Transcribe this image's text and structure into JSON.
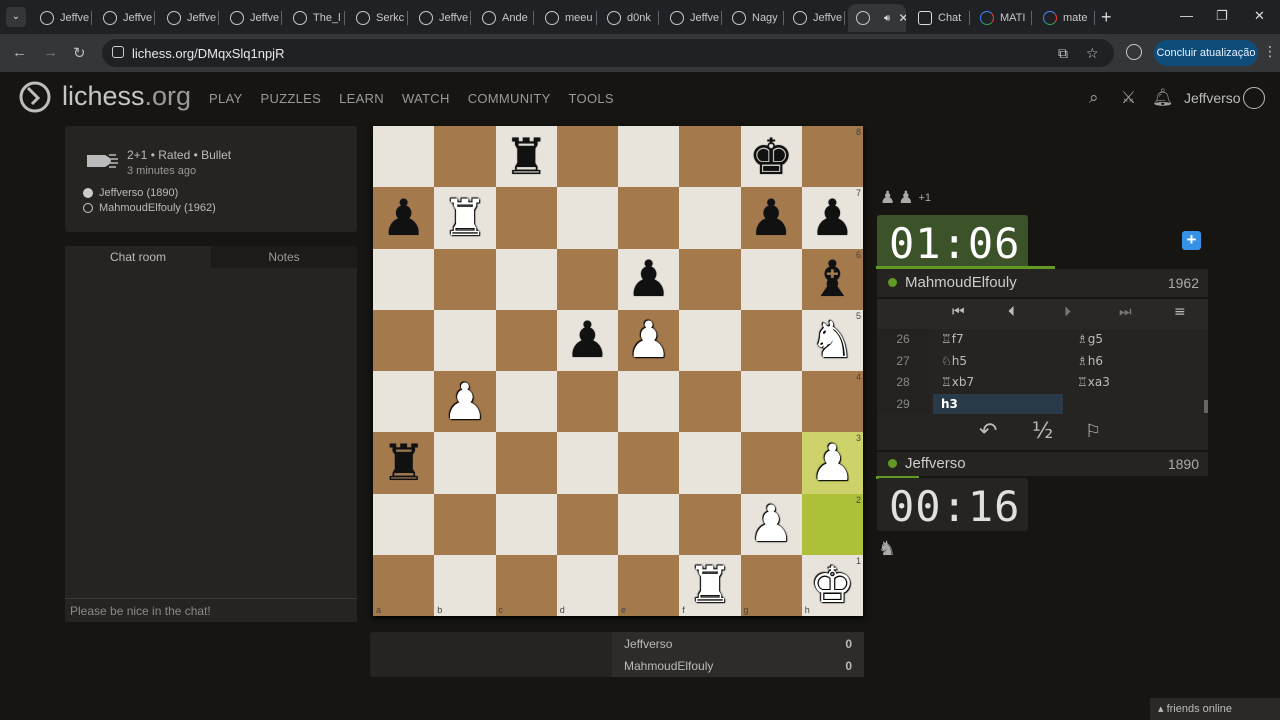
{
  "browser": {
    "tabs": [
      {
        "label": "Jeffve",
        "icon": "lichess-icon"
      },
      {
        "label": "Jeffve",
        "icon": "lichess-icon"
      },
      {
        "label": "Jeffve",
        "icon": "lichess-icon"
      },
      {
        "label": "Jeffve",
        "icon": "lichess-icon"
      },
      {
        "label": "The_l",
        "icon": "lichess-icon"
      },
      {
        "label": "Serkc",
        "icon": "lichess-icon"
      },
      {
        "label": "Jeffve",
        "icon": "lichess-icon"
      },
      {
        "label": "Ande",
        "icon": "lichess-icon"
      },
      {
        "label": "meeu",
        "icon": "lichess-icon"
      },
      {
        "label": "d0nk",
        "icon": "lichess-icon"
      },
      {
        "label": "Jeffve",
        "icon": "lichess-icon"
      },
      {
        "label": "Nagy",
        "icon": "lichess-icon"
      },
      {
        "label": "Jeffve",
        "icon": "lichess-icon"
      },
      {
        "label": "",
        "icon": "lichess-icon",
        "active": true
      },
      {
        "label": "Chat",
        "icon": "chatgpt-icon"
      },
      {
        "label": "MATI",
        "icon": "google-icon"
      },
      {
        "label": "mate",
        "icon": "google-icon"
      }
    ],
    "url": "lichess.org/DMqxSlq1npjR",
    "update_button": "Concluir atualização"
  },
  "site": {
    "logo_main": "lichess",
    "logo_tld": ".org",
    "nav": [
      "PLAY",
      "PUZZLES",
      "LEARN",
      "WATCH",
      "COMMUNITY",
      "TOOLS"
    ],
    "username": "Jeffverso"
  },
  "game_info": {
    "type": "2+1 • Rated • Bullet",
    "time_ago": "3 minutes ago",
    "white_player": "Jeffverso (1890)",
    "black_player": "MahmoudElfouly (1962)"
  },
  "chat": {
    "tab_chat": "Chat room",
    "tab_notes": "Notes",
    "placeholder": "Please be nice in the chat!"
  },
  "board": {
    "files": [
      "a",
      "b",
      "c",
      "d",
      "e",
      "f",
      "g",
      "h"
    ],
    "ranks": [
      "8",
      "7",
      "6",
      "5",
      "4",
      "3",
      "2",
      "1"
    ],
    "rows": [
      [
        "",
        "",
        "bR",
        "",
        "",
        "",
        "bK",
        ""
      ],
      [
        "bP",
        "wR",
        "",
        "",
        "",
        "",
        "bP",
        "bP"
      ],
      [
        "",
        "",
        "",
        "",
        "bP",
        "",
        "",
        "bB"
      ],
      [
        "",
        "",
        "",
        "bP",
        "wP",
        "",
        "",
        "wN"
      ],
      [
        "",
        "wP",
        "",
        "",
        "",
        "",
        "",
        ""
      ],
      [
        "bR",
        "",
        "",
        "",
        "",
        "",
        "",
        "wP"
      ],
      [
        "",
        "",
        "",
        "",
        "",
        "",
        "wP",
        ""
      ],
      [
        "",
        "",
        "",
        "",
        "",
        "wR",
        "",
        "wK"
      ]
    ],
    "last_move": [
      "h2",
      "h3"
    ]
  },
  "opponent": {
    "name": "MahmoudElfouly",
    "rating": "1962",
    "clock": "01:06",
    "clock_fraction": 0.54,
    "material_diff": "+1",
    "captured": [
      "♟",
      "♟"
    ]
  },
  "self": {
    "name": "Jeffverso",
    "rating": "1890",
    "clock": "00:16",
    "clock_fraction": 0.13,
    "captured": [
      "♞"
    ]
  },
  "moves": [
    {
      "num": "26",
      "white": "♖f7",
      "black": "♗g5"
    },
    {
      "num": "27",
      "white": "♘h5",
      "black": "♗h6"
    },
    {
      "num": "28",
      "white": "♖xb7",
      "black": "♖xa3"
    },
    {
      "num": "29",
      "white": "h3",
      "black": ""
    }
  ],
  "crosstable": {
    "player1": "Jeffverso",
    "score1": "0",
    "player2": "MahmoudElfouly",
    "score2": "0"
  },
  "footer": {
    "friends": "friends online"
  },
  "colors": {
    "accent_green": "#629924",
    "board_light": "#e8e4dc",
    "board_dark": "#a47a4c",
    "highlight": "#aebf3a",
    "plus_blue": "#3692e7"
  }
}
